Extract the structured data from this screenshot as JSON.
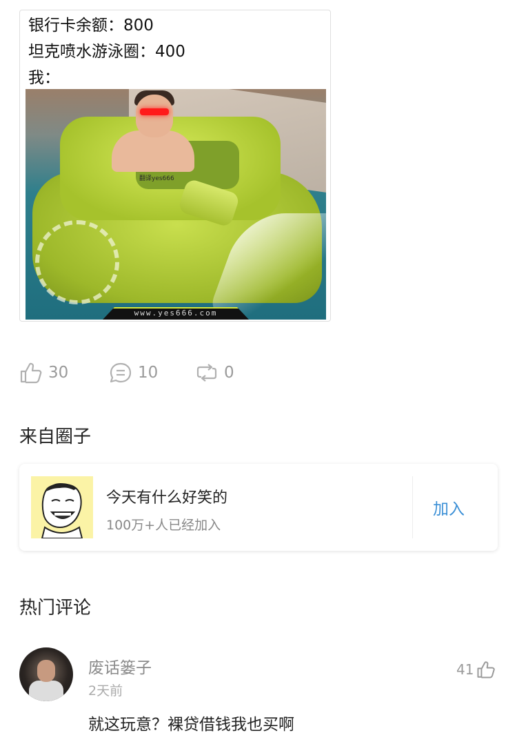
{
  "post": {
    "meme_lines": [
      "银行卡余额：800",
      "坦克喷水游泳圈：400",
      "我："
    ],
    "photo_watermark": "翻译yes666",
    "photo_url": "www.yes666.com",
    "stats": {
      "likes": "30",
      "comments": "10",
      "reposts": "0"
    }
  },
  "circle_section": {
    "title": "来自圈子",
    "circle": {
      "name": "今天有什么好笑的",
      "members": "100万+人已经加入",
      "join_label": "加入"
    }
  },
  "comments_section": {
    "title": "热门评论",
    "comments": [
      {
        "user": "废话篓子",
        "time": "2天前",
        "likes": "41",
        "text": "就这玩意？裸贷借钱我也买啊"
      }
    ]
  },
  "colors": {
    "accent": "#3a8fd6",
    "muted_text": "#9a9a9a",
    "tank_green": "#b5cf3a"
  },
  "icons": [
    "thumbs-up-icon",
    "comment-icon",
    "repost-icon"
  ]
}
